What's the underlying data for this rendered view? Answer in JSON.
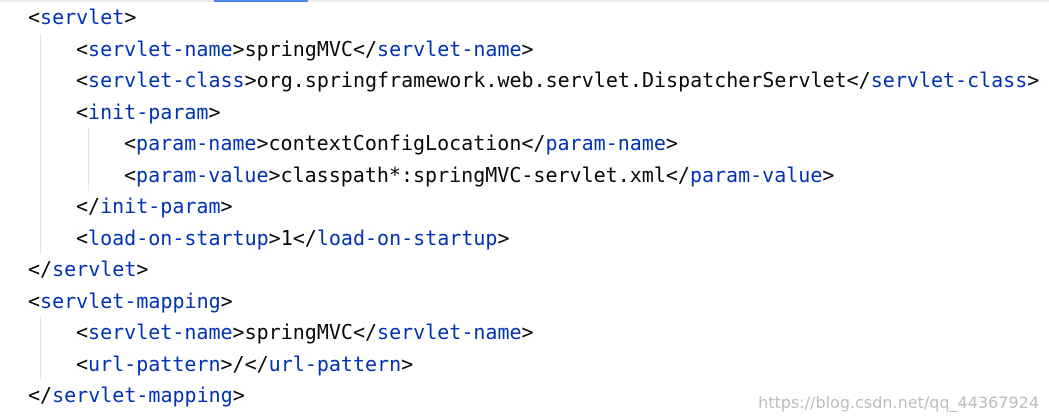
{
  "code": {
    "language": "xml",
    "lines": [
      {
        "indent": 0,
        "segments": [
          {
            "t": "<"
          },
          {
            "t": "servlet",
            "c": "tag"
          },
          {
            "t": ">"
          }
        ]
      },
      {
        "indent": 1,
        "segments": [
          {
            "t": "<"
          },
          {
            "t": "servlet-name",
            "c": "tag"
          },
          {
            "t": ">springMVC</"
          },
          {
            "t": "servlet-name",
            "c": "tag"
          },
          {
            "t": ">"
          }
        ]
      },
      {
        "indent": 1,
        "segments": [
          {
            "t": "<"
          },
          {
            "t": "servlet-class",
            "c": "tag"
          },
          {
            "t": ">org.springframework.web.servlet.DispatcherServlet</"
          },
          {
            "t": "servlet-class",
            "c": "tag"
          },
          {
            "t": ">"
          }
        ]
      },
      {
        "indent": 1,
        "segments": [
          {
            "t": "<"
          },
          {
            "t": "init-param",
            "c": "tag"
          },
          {
            "t": ">"
          }
        ]
      },
      {
        "indent": 2,
        "segments": [
          {
            "t": "<"
          },
          {
            "t": "param-name",
            "c": "tag"
          },
          {
            "t": ">contextConfigLocation</"
          },
          {
            "t": "param-name",
            "c": "tag"
          },
          {
            "t": ">"
          }
        ]
      },
      {
        "indent": 2,
        "segments": [
          {
            "t": "<"
          },
          {
            "t": "param-value",
            "c": "tag"
          },
          {
            "t": ">classpath*:springMVC-servlet.xml</"
          },
          {
            "t": "param-value",
            "c": "tag"
          },
          {
            "t": ">"
          }
        ]
      },
      {
        "indent": 1,
        "segments": [
          {
            "t": "</"
          },
          {
            "t": "init-param",
            "c": "tag"
          },
          {
            "t": ">"
          }
        ]
      },
      {
        "indent": 1,
        "segments": [
          {
            "t": "<"
          },
          {
            "t": "load-on-startup",
            "c": "tag"
          },
          {
            "t": ">1</"
          },
          {
            "t": "load-on-startup",
            "c": "tag"
          },
          {
            "t": ">"
          }
        ]
      },
      {
        "indent": 0,
        "segments": [
          {
            "t": "</"
          },
          {
            "t": "servlet",
            "c": "tag"
          },
          {
            "t": ">"
          }
        ]
      },
      {
        "indent": 0,
        "segments": [
          {
            "t": "<"
          },
          {
            "t": "servlet-mapping",
            "c": "tag"
          },
          {
            "t": ">"
          }
        ]
      },
      {
        "indent": 1,
        "segments": [
          {
            "t": "<"
          },
          {
            "t": "servlet-name",
            "c": "tag"
          },
          {
            "t": ">springMVC</"
          },
          {
            "t": "servlet-name",
            "c": "tag"
          },
          {
            "t": ">"
          }
        ]
      },
      {
        "indent": 1,
        "segments": [
          {
            "t": "<"
          },
          {
            "t": "url-pattern",
            "c": "tag"
          },
          {
            "t": ">/</"
          },
          {
            "t": "url-pattern",
            "c": "tag"
          },
          {
            "t": ">"
          }
        ]
      },
      {
        "indent": 0,
        "segments": [
          {
            "t": "</"
          },
          {
            "t": "servlet-mapping",
            "c": "tag"
          },
          {
            "t": ">"
          }
        ]
      }
    ]
  },
  "colors": {
    "tag": "#0033b3",
    "text": "#080808",
    "guide": "#e3e3e3",
    "watermark": "#bdbdbd"
  },
  "watermark": "https://blog.csdn.net/qq_44367924"
}
